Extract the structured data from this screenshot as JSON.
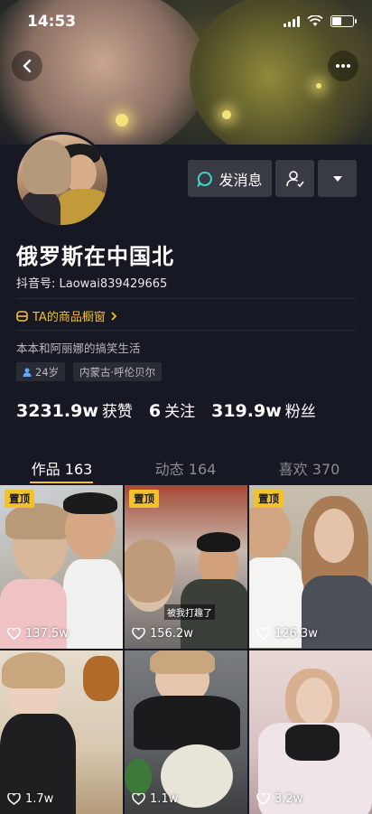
{
  "status_bar": {
    "time": "14:53"
  },
  "profile": {
    "name": "俄罗斯在中国北",
    "douyin_id": "抖音号: Laowai839429665",
    "shop_label": "TA的商品橱窗",
    "bio": "本本和阿丽娜的搞笑生活",
    "tags": [
      {
        "label": "24岁",
        "icon": "person-icon"
      },
      {
        "label": "内蒙古·呼伦贝尔"
      }
    ],
    "stats": [
      {
        "value": "3231.9w",
        "label": "获赞"
      },
      {
        "value": "6",
        "label": "关注"
      },
      {
        "value": "319.9w",
        "label": "粉丝"
      }
    ]
  },
  "actions": {
    "message_label": "发消息",
    "follow_icon": "user-check-icon",
    "more_icon": "chevron-down-icon"
  },
  "tabs": [
    {
      "label": "作品 163",
      "active": true
    },
    {
      "label": "动态 164",
      "active": false
    },
    {
      "label": "喜欢 370",
      "active": false
    }
  ],
  "videos": [
    {
      "pinned": true,
      "pin_label": "置顶",
      "likes": "137.5w"
    },
    {
      "pinned": true,
      "pin_label": "置顶",
      "likes": "156.2w",
      "caption": "被我打趣了"
    },
    {
      "pinned": true,
      "pin_label": "置顶",
      "likes": "126.3w"
    },
    {
      "pinned": false,
      "likes": "1.7w"
    },
    {
      "pinned": false,
      "likes": "1.1w"
    },
    {
      "pinned": false,
      "likes": "3.2w"
    }
  ],
  "colors": {
    "background": "#161823",
    "accent": "#f3c12c",
    "button": "#393b44"
  }
}
